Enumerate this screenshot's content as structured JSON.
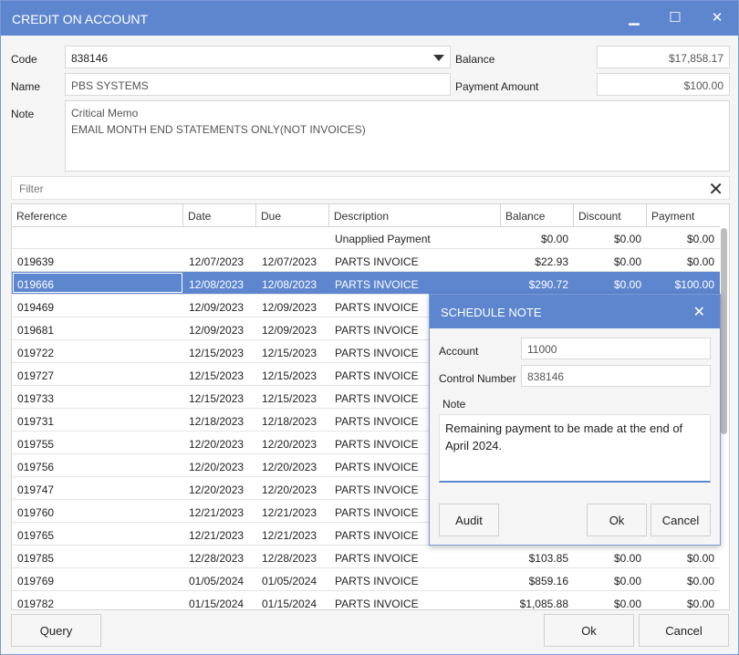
{
  "window": {
    "title": "CREDIT ON ACCOUNT",
    "minimize_glyph": "▁",
    "maximize_glyph": "☐",
    "close_glyph": "✕"
  },
  "form": {
    "code_label": "Code",
    "code_value": "838146",
    "name_label": "Name",
    "name_value": "PBS SYSTEMS",
    "note_label": "Note",
    "note_lines": [
      "Critical Memo",
      "EMAIL MONTH END STATEMENTS ONLY(NOT INVOICES)"
    ],
    "balance_label": "Balance",
    "balance_value": "$17,858.17",
    "payment_amount_label": "Payment Amount",
    "payment_amount_value": "$100.00"
  },
  "filter": {
    "placeholder": "Filter",
    "clear_glyph": "✕"
  },
  "grid": {
    "columns": [
      "Reference",
      "Date",
      "Due",
      "Description",
      "Balance",
      "Discount",
      "Payment"
    ],
    "rows": [
      [
        "",
        "",
        "",
        "Unapplied Payment",
        "$0.00",
        "$0.00",
        "$0.00"
      ],
      [
        "019639",
        "12/07/2023",
        "12/07/2023",
        "PARTS INVOICE",
        "$22.93",
        "$0.00",
        "$0.00"
      ],
      [
        "019666",
        "12/08/2023",
        "12/08/2023",
        "PARTS INVOICE",
        "$290.72",
        "$0.00",
        "$100.00"
      ],
      [
        "019469",
        "12/09/2023",
        "12/09/2023",
        "PARTS INVOICE",
        "",
        "",
        ""
      ],
      [
        "019681",
        "12/09/2023",
        "12/09/2023",
        "PARTS INVOICE",
        "",
        "",
        ""
      ],
      [
        "019722",
        "12/15/2023",
        "12/15/2023",
        "PARTS INVOICE",
        "",
        "",
        ""
      ],
      [
        "019727",
        "12/15/2023",
        "12/15/2023",
        "PARTS INVOICE",
        "",
        "",
        ""
      ],
      [
        "019733",
        "12/15/2023",
        "12/15/2023",
        "PARTS INVOICE",
        "",
        "",
        ""
      ],
      [
        "019731",
        "12/18/2023",
        "12/18/2023",
        "PARTS INVOICE",
        "",
        "",
        ""
      ],
      [
        "019755",
        "12/20/2023",
        "12/20/2023",
        "PARTS INVOICE",
        "",
        "",
        ""
      ],
      [
        "019756",
        "12/20/2023",
        "12/20/2023",
        "PARTS INVOICE",
        "",
        "",
        ""
      ],
      [
        "019747",
        "12/20/2023",
        "12/20/2023",
        "PARTS INVOICE",
        "",
        "",
        ""
      ],
      [
        "019760",
        "12/21/2023",
        "12/21/2023",
        "PARTS INVOICE",
        "",
        "",
        ""
      ],
      [
        "019765",
        "12/21/2023",
        "12/21/2023",
        "PARTS INVOICE",
        "",
        "",
        ""
      ],
      [
        "019785",
        "12/28/2023",
        "12/28/2023",
        "PARTS INVOICE",
        "$103.85",
        "$0.00",
        "$0.00"
      ],
      [
        "019769",
        "01/05/2024",
        "01/05/2024",
        "PARTS INVOICE",
        "$859.16",
        "$0.00",
        "$0.00"
      ],
      [
        "019782",
        "01/15/2024",
        "01/15/2024",
        "PARTS INVOICE",
        "$1,085.88",
        "$0.00",
        "$0.00"
      ]
    ],
    "selected_row": 2
  },
  "buttons": {
    "query": "Query",
    "ok": "Ok",
    "cancel": "Cancel"
  },
  "schedule_note": {
    "title": "SCHEDULE NOTE",
    "close_glyph": "✕",
    "account_label": "Account",
    "account_value": "11000",
    "control_number_label": "Control Number",
    "control_number_value": "838146",
    "note_label": "Note",
    "note_text": "Remaining payment to be made at the end of April 2024.",
    "audit_button": "Audit",
    "ok_button": "Ok",
    "cancel_button": "Cancel"
  },
  "colors": {
    "accent": "#5e86cf",
    "selection": "#5e86cf"
  }
}
